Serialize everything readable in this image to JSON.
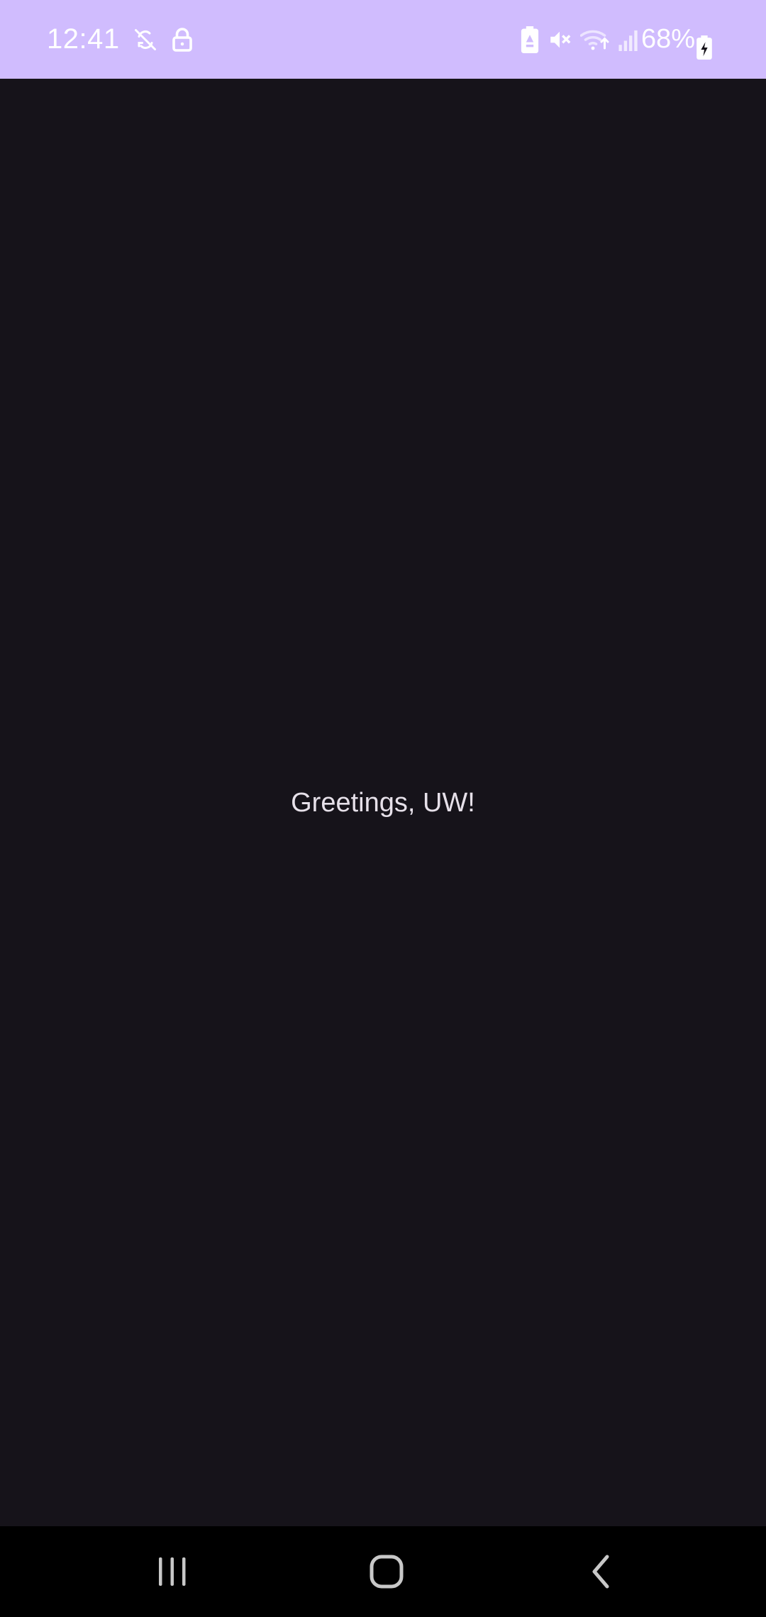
{
  "status_bar": {
    "time": "12:41",
    "battery_percent": "68%",
    "background_color": "#d0bcfe",
    "left_icons": [
      "sync-off-icon",
      "lock-icon"
    ],
    "right_icons": [
      "battery-saver-icon",
      "mute-icon",
      "wifi-icon",
      "signal-icon",
      "battery-icon"
    ]
  },
  "main": {
    "greeting": "Greetings, UW!",
    "background_color": "#16131a",
    "text_color": "#e6e0e9"
  },
  "nav_bar": {
    "buttons": [
      "recent-apps",
      "home",
      "back"
    ],
    "background_color": "#000000"
  }
}
